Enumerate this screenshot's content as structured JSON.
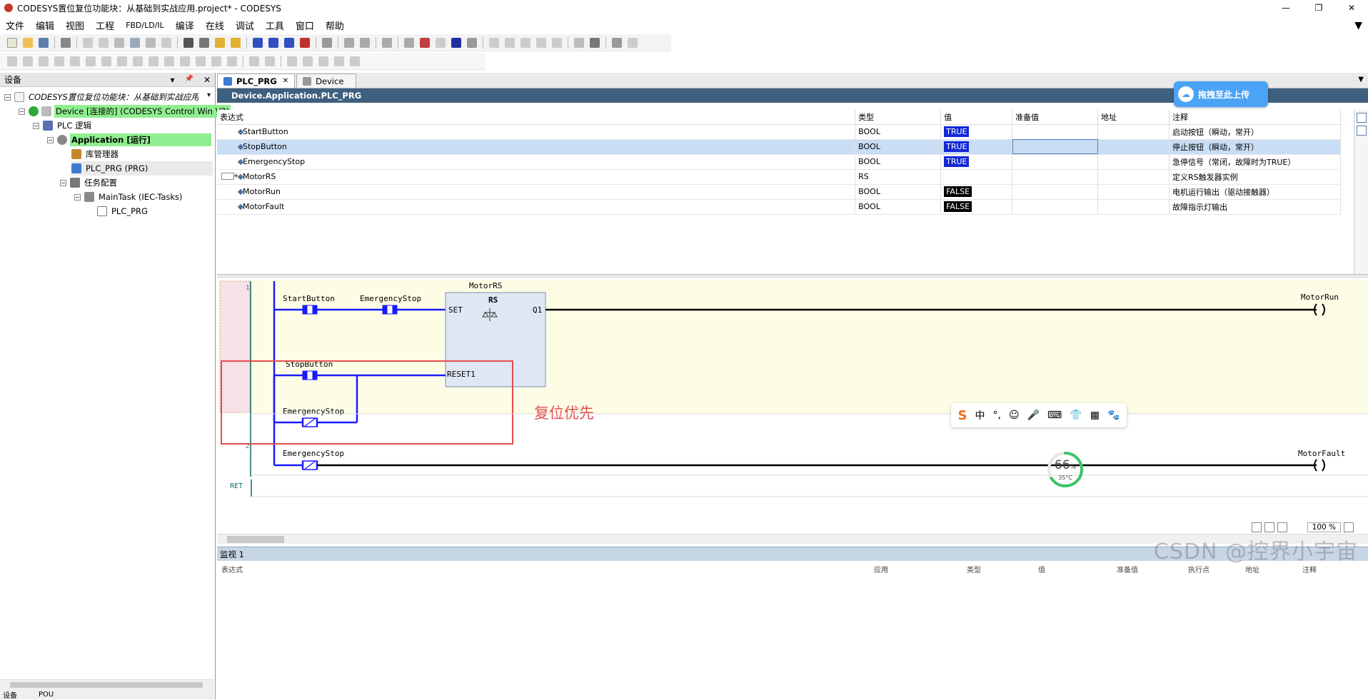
{
  "window": {
    "title": "CODESYS置位复位功能块：从基础到实战应用.project* - CODESYS",
    "controls": [
      "—",
      "❐",
      "✕"
    ]
  },
  "menu": [
    "文件",
    "编辑",
    "视图",
    "工程",
    "FBD/LD/IL",
    "编译",
    "在线",
    "调试",
    "工具",
    "窗口",
    "帮助"
  ],
  "devices_panel": {
    "title": "设备",
    "pin": "📌",
    "close": "✕",
    "tree": {
      "project": "CODESYS置位复位功能块：从基础到实战应用",
      "device": "Device [连接的] (CODESYS Control Win V3)",
      "plc_logic": "PLC 逻辑",
      "application": "Application [运行]",
      "library_manager": "库管理器",
      "plc_prg": "PLC_PRG (PRG)",
      "task_config": "任务配置",
      "main_task": "MainTask (IEC-Tasks)",
      "task_prg": "PLC_PRG"
    },
    "footer_tabs": [
      "设备",
      "POU"
    ]
  },
  "editor": {
    "tabs": [
      {
        "label": "PLC_PRG",
        "close": "✕"
      },
      {
        "label": "Device"
      }
    ],
    "path": "Device.Application.PLC_PRG",
    "upload_button": "拖拽至此上传",
    "columns": [
      "表达式",
      "类型",
      "值",
      "准备值",
      "地址",
      "注释"
    ],
    "variables": [
      {
        "name": "StartButton",
        "type": "BOOL",
        "value": "TRUE",
        "value_kind": "true",
        "comment": "启动按钮（瞬动，常开）"
      },
      {
        "name": "StopButton",
        "type": "BOOL",
        "value": "TRUE",
        "value_kind": "true",
        "comment": "停止按钮（瞬动，常开）"
      },
      {
        "name": "EmergencyStop",
        "type": "BOOL",
        "value": "TRUE",
        "value_kind": "true",
        "comment": "急停信号（常闭，故障时为TRUE）"
      },
      {
        "name": "MotorRS",
        "type": "RS",
        "value": "",
        "value_kind": "",
        "comment": "定义RS触发器实例"
      },
      {
        "name": "MotorRun",
        "type": "BOOL",
        "value": "FALSE",
        "value_kind": "false",
        "comment": "电机运行输出（驱动接触器）"
      },
      {
        "name": "MotorFault",
        "type": "BOOL",
        "value": "FALSE",
        "value_kind": "false",
        "comment": "故障指示灯输出"
      }
    ]
  },
  "ladder": {
    "network1": {
      "number": "1",
      "contact1": "StartButton",
      "contact2": "EmergencyStop",
      "fb_instance": "MotorRS",
      "fb_type": "RS",
      "pin_set": "SET",
      "pin_reset": "RESET1",
      "pin_q1": "Q1",
      "contact3": "StopButton",
      "contact4": "EmergencyStop",
      "coil": "MotorRun",
      "annotation": "复位优先"
    },
    "network2": {
      "number": "2",
      "contact": "EmergencyStop",
      "coil": "MotorFault"
    },
    "ret": "RET",
    "zoom": "100 %"
  },
  "ime_toolbar": [
    "中",
    "°,",
    "☺",
    "🎤",
    "⌨",
    "👕",
    "▦",
    "🐾"
  ],
  "system_gauge": {
    "percent": "66",
    "unit": "%",
    "temp": "35°C"
  },
  "watch": {
    "title": "监视 1",
    "columns": [
      "表达式",
      "应用",
      "类型",
      "值",
      "准备值",
      "执行点",
      "地址",
      "注释"
    ]
  },
  "watermark": "CSDN @控界小宇宙",
  "colors": {
    "path_bar": "#3f5f7f",
    "true_value": "#1428d4",
    "false_value": "#000000",
    "network_bg": "#fdfde6",
    "rung_line": "#1a1aff",
    "annotation_red": "#e34d4d",
    "tree_highlight": "#90ee90"
  }
}
